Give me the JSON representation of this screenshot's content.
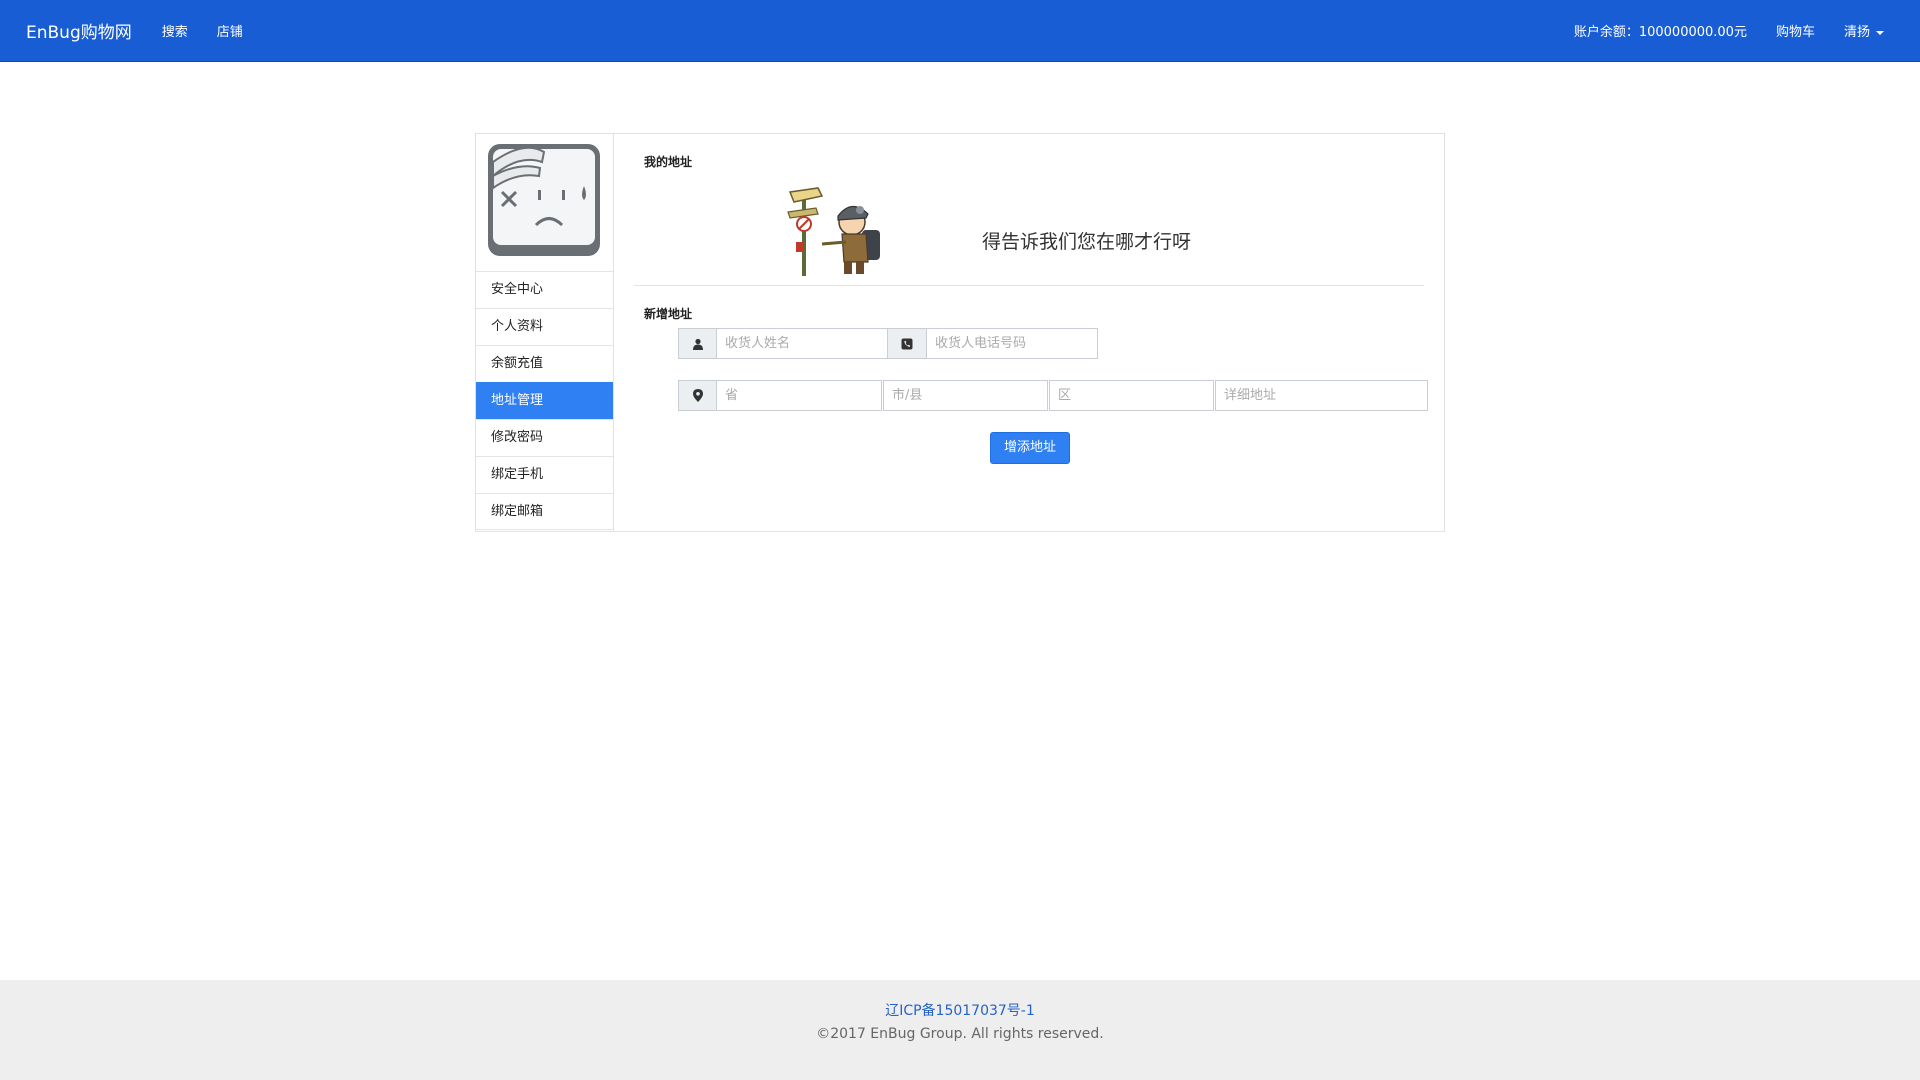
{
  "navbar": {
    "brand": "EnBug购物网",
    "links": [
      "搜索",
      "店铺"
    ],
    "balance": "账户余额：100000000.00元",
    "cart": "购物车",
    "user": "清扬"
  },
  "sidebar": {
    "menu": [
      "安全中心",
      "个人资料",
      "余额充值",
      "地址管理",
      "修改密码",
      "绑定手机",
      "绑定邮箱"
    ],
    "active_index": 3
  },
  "content": {
    "my_address_title": "我的地址",
    "empty_message": "得告诉我们您在哪才行呀",
    "new_address_title": "新增地址",
    "name_placeholder": "收货人姓名",
    "phone_placeholder": "收货人电话号码",
    "province_placeholder": "省",
    "city_placeholder": "市/县",
    "district_placeholder": "区",
    "detail_placeholder": "详细地址",
    "add_button": "增添地址"
  },
  "footer": {
    "icp": "辽ICP备15017037号-1",
    "copyright": "©2017 EnBug Group. All rights reserved."
  },
  "icons": [
    "sad-face-avatar-icon",
    "user-icon",
    "phone-icon",
    "map-marker-icon",
    "caret-down-icon"
  ],
  "colors": {
    "navbar": "#185dd4",
    "accent": "#2f80f2",
    "footer_bg": "#eeeeee",
    "link": "#2463c8"
  }
}
